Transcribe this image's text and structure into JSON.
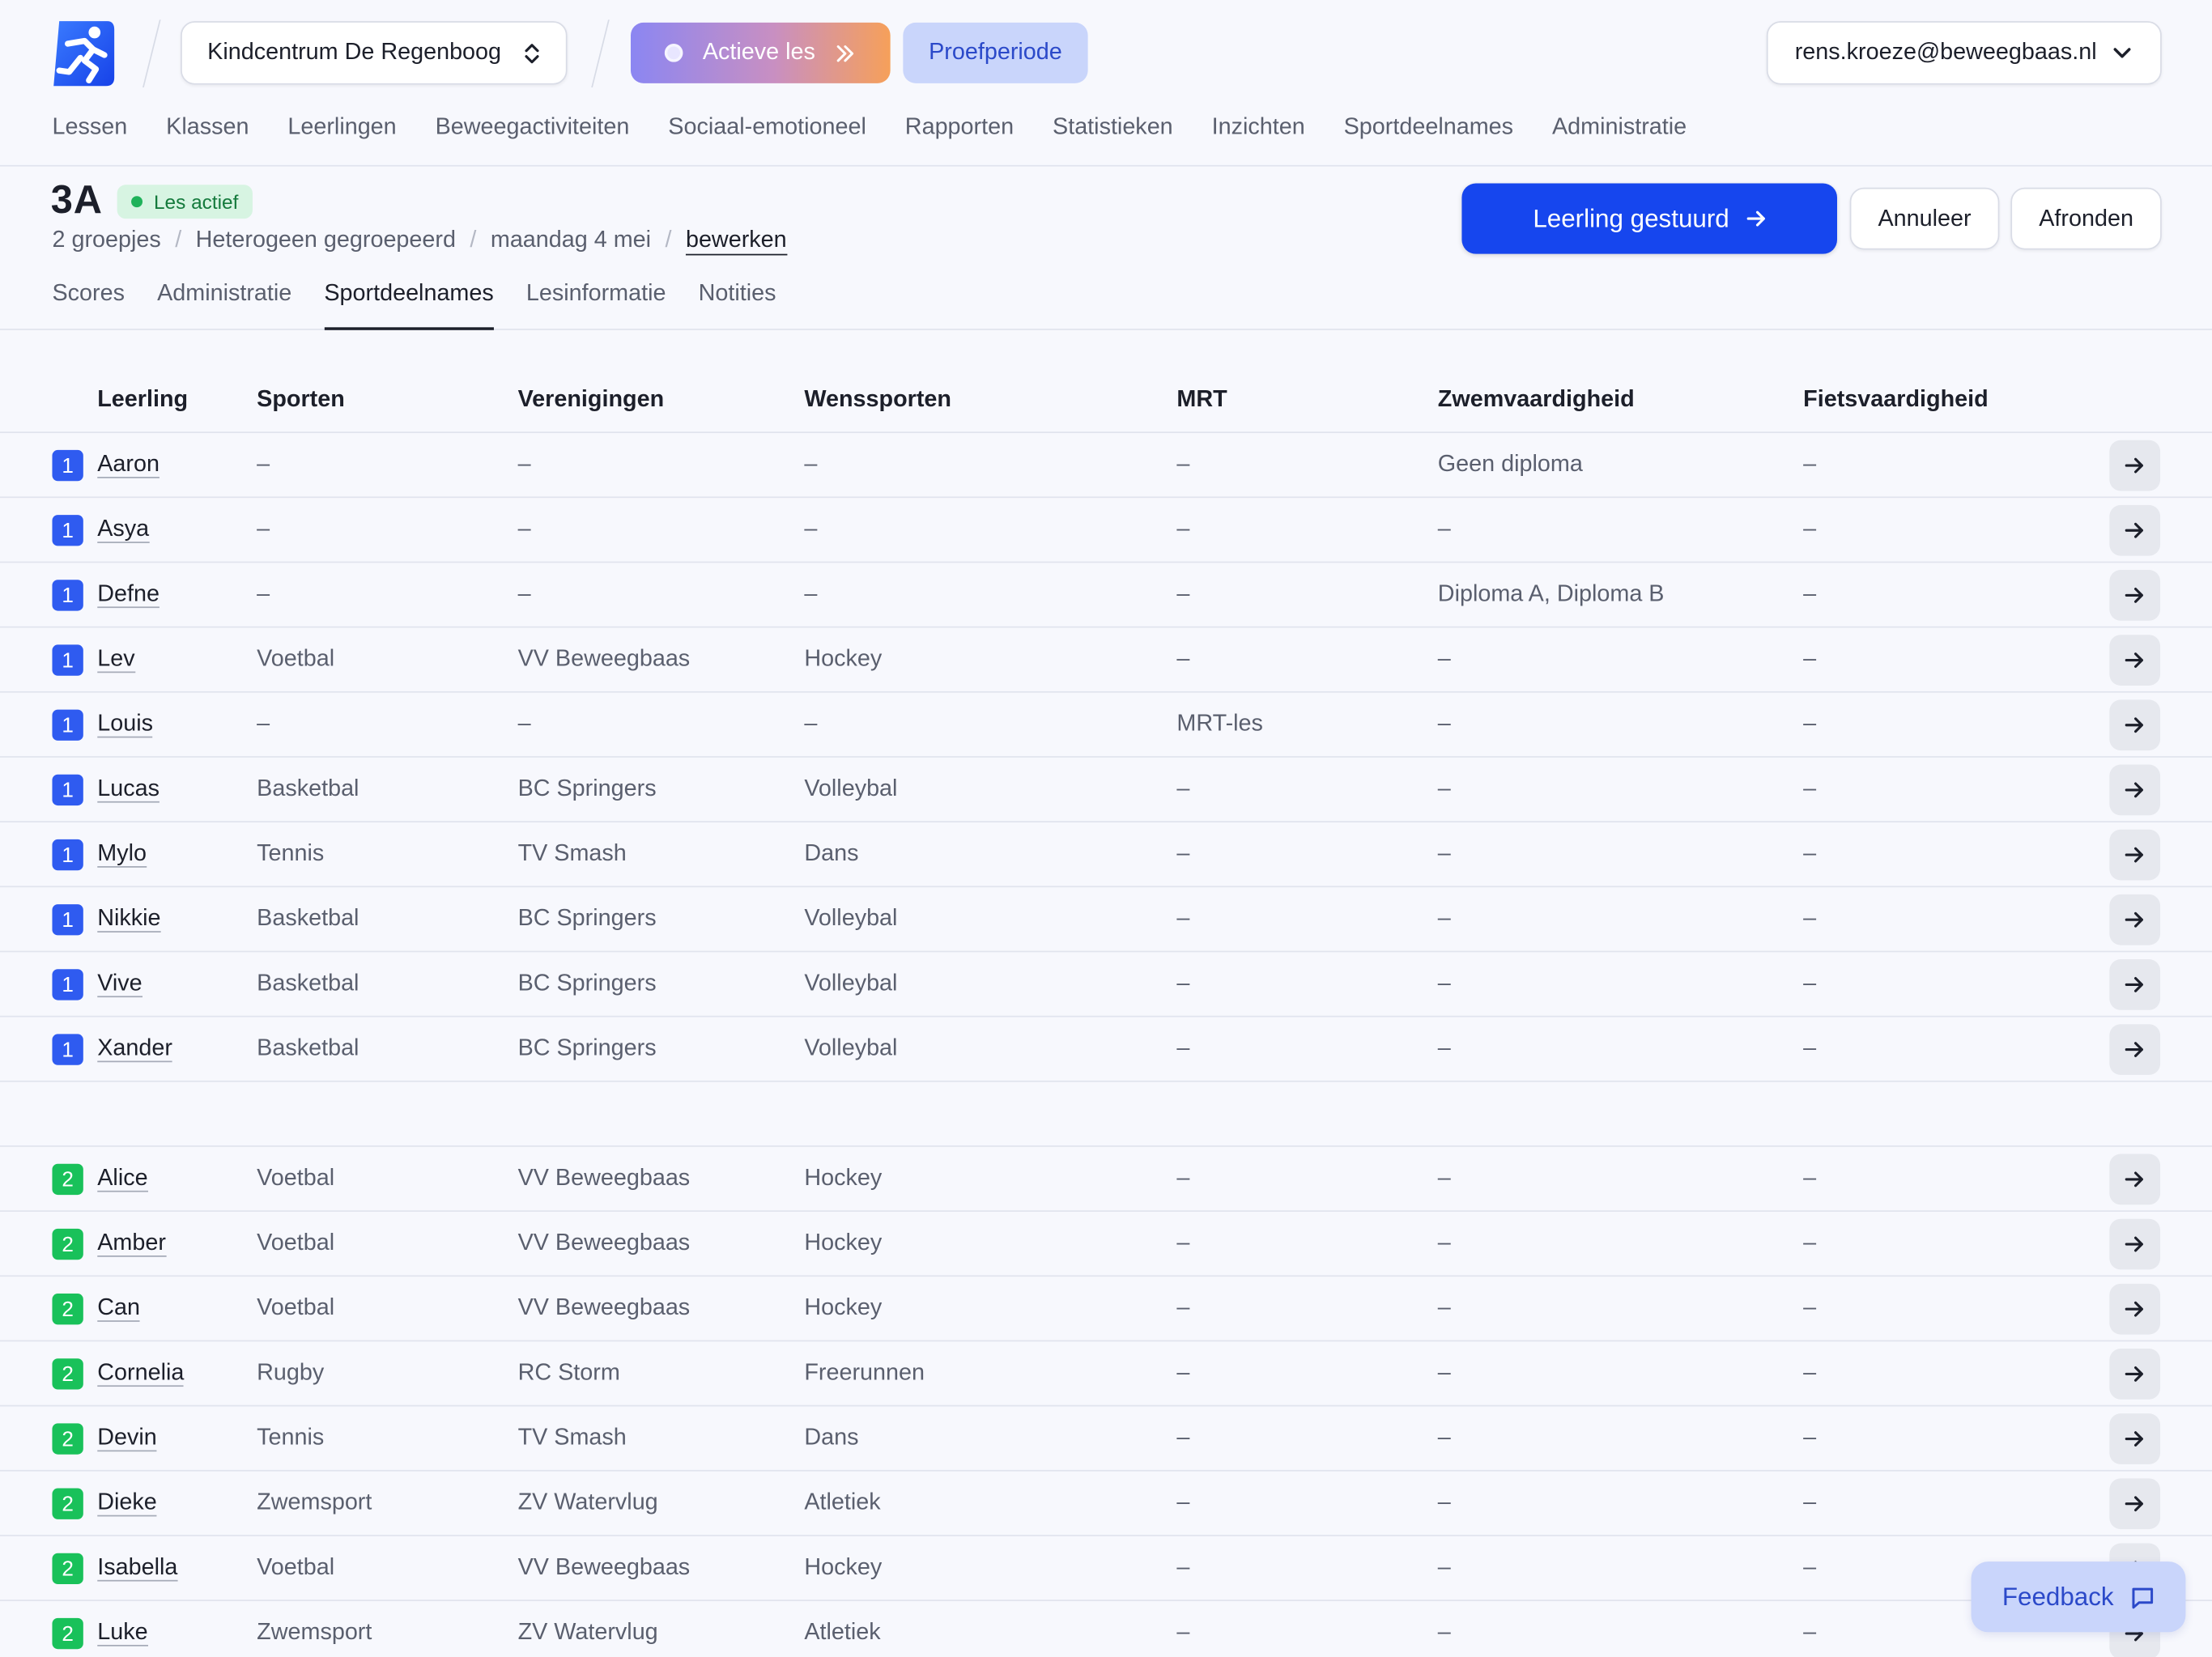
{
  "header": {
    "school": "Kindcentrum De Regenboog",
    "active_lesson": "Actieve les",
    "trial": "Proefperiode",
    "user": "rens.kroeze@beweegbaas.nl",
    "nav": [
      "Lessen",
      "Klassen",
      "Leerlingen",
      "Beweegactiviteiten",
      "Sociaal-emotioneel",
      "Rapporten",
      "Statistieken",
      "Inzichten",
      "Sportdeelnames",
      "Administratie"
    ]
  },
  "lesson": {
    "class_name": "3A",
    "status": "Les actief",
    "crumbs": [
      "2 groepjes",
      "Heterogeen gegroepeerd",
      "maandag 4 mei"
    ],
    "edit": "bewerken",
    "tabs": [
      "Scores",
      "Administratie",
      "Sportdeelnames",
      "Lesinformatie",
      "Notities"
    ],
    "active_tab": "Sportdeelnames",
    "primary_button": "Leerling gestuurd",
    "cancel_button": "Annuleer",
    "finish_button": "Afronden"
  },
  "colors": {
    "group1": "#2f5bf0",
    "group2": "#19c15a",
    "primary": "#1646ee"
  },
  "table": {
    "columns": [
      "Leerling",
      "Sporten",
      "Verenigingen",
      "Wenssporten",
      "MRT",
      "Zwemvaardigheid",
      "Fietsvaardigheid"
    ],
    "groups": [
      {
        "number": "1",
        "rows": [
          [
            "Aaron",
            "–",
            "–",
            "–",
            "–",
            "Geen diploma",
            "–"
          ],
          [
            "Asya",
            "–",
            "–",
            "–",
            "–",
            "–",
            "–"
          ],
          [
            "Defne",
            "–",
            "–",
            "–",
            "–",
            "Diploma A, Diploma B",
            "–"
          ],
          [
            "Lev",
            "Voetbal",
            "VV Beweegbaas",
            "Hockey",
            "–",
            "–",
            "–"
          ],
          [
            "Louis",
            "–",
            "–",
            "–",
            "MRT-les",
            "–",
            "–"
          ],
          [
            "Lucas",
            "Basketbal",
            "BC Springers",
            "Volleybal",
            "–",
            "–",
            "–"
          ],
          [
            "Mylo",
            "Tennis",
            "TV Smash",
            "Dans",
            "–",
            "–",
            "–"
          ],
          [
            "Nikkie",
            "Basketbal",
            "BC Springers",
            "Volleybal",
            "–",
            "–",
            "–"
          ],
          [
            "Vive",
            "Basketbal",
            "BC Springers",
            "Volleybal",
            "–",
            "–",
            "–"
          ],
          [
            "Xander",
            "Basketbal",
            "BC Springers",
            "Volleybal",
            "–",
            "–",
            "–"
          ]
        ]
      },
      {
        "number": "2",
        "rows": [
          [
            "Alice",
            "Voetbal",
            "VV Beweegbaas",
            "Hockey",
            "–",
            "–",
            "–"
          ],
          [
            "Amber",
            "Voetbal",
            "VV Beweegbaas",
            "Hockey",
            "–",
            "–",
            "–"
          ],
          [
            "Can",
            "Voetbal",
            "VV Beweegbaas",
            "Hockey",
            "–",
            "–",
            "–"
          ],
          [
            "Cornelia",
            "Rugby",
            "RC Storm",
            "Freerunnen",
            "–",
            "–",
            "–"
          ],
          [
            "Devin",
            "Tennis",
            "TV Smash",
            "Dans",
            "–",
            "–",
            "–"
          ],
          [
            "Dieke",
            "Zwemsport",
            "ZV Watervlug",
            "Atletiek",
            "–",
            "–",
            "–"
          ],
          [
            "Isabella",
            "Voetbal",
            "VV Beweegbaas",
            "Hockey",
            "–",
            "–",
            "–"
          ],
          [
            "Luke",
            "Zwemsport",
            "ZV Watervlug",
            "Atletiek",
            "–",
            "–",
            "–"
          ]
        ]
      }
    ]
  },
  "feedback": "Feedback"
}
